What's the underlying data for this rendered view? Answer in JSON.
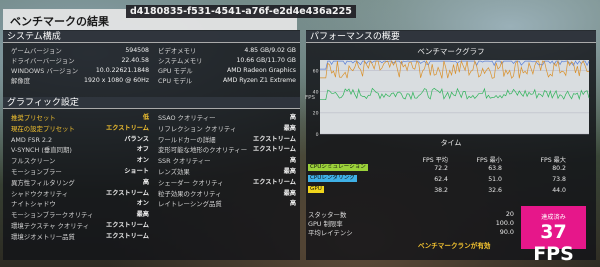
{
  "header": {
    "title": "ベンチマークの結果",
    "id": "d4180835-f531-4541-a76f-e2d4e436a225"
  },
  "system": {
    "title": "システム構成",
    "left": [
      {
        "label": "ゲームバージョン",
        "value": "594508"
      },
      {
        "label": "ドライバーバージョン",
        "value": "22.40.58"
      },
      {
        "label": "WINDOWS バージョン",
        "value": "10.0.22621.1848"
      },
      {
        "label": "解像度",
        "value": "1920 x 1080 @ 60Hz"
      }
    ],
    "right": [
      {
        "label": "ビデオメモリ",
        "value": "4.85 GB/9.02 GB"
      },
      {
        "label": "システムメモリ",
        "value": "10.66 GB/11.70 GB"
      },
      {
        "label": "GPU モデル",
        "value": "AMD Radeon Graphics"
      },
      {
        "label": "CPU モデル",
        "value": "AMD Ryzen Z1 Extreme"
      }
    ]
  },
  "graphics": {
    "title": "グラフィック設定",
    "left": [
      {
        "label": "推奨プリセット",
        "value": "低",
        "hl": true
      },
      {
        "label": "現在の設定プリセット",
        "value": "エクストリーム",
        "hl": true
      },
      {
        "label": "AMD FSR 2.2",
        "value": "バランス"
      },
      {
        "label": "V-SYNCH (垂直同期)",
        "value": "オフ"
      },
      {
        "label": "フルスクリーン",
        "value": "オン"
      },
      {
        "label": "モーションブラー",
        "value": "ショート"
      },
      {
        "label": "異方性フィルタリング",
        "value": "高"
      },
      {
        "label": "シャドウクオリティ",
        "value": "エクストリーム"
      },
      {
        "label": "ナイトシャドウ",
        "value": "オン"
      },
      {
        "label": "モーションブラークオリティ",
        "value": "最高"
      },
      {
        "label": "環境テクスチャ クオリティ",
        "value": "エクストリーム"
      },
      {
        "label": "環境ジオメトリー品質",
        "value": "エクストリーム"
      }
    ],
    "right": [
      {
        "label": "SSAO クオリティー",
        "value": "高"
      },
      {
        "label": "リフレクション クオリティ",
        "value": "最高"
      },
      {
        "label": "ワールドカーの詳細",
        "value": "エクストリーム"
      },
      {
        "label": "変形可能な地形のクオリティー",
        "value": "エクストリーム"
      },
      {
        "label": "SSR クオリティー",
        "value": "高"
      },
      {
        "label": "レンズ効果",
        "value": "最高"
      },
      {
        "label": "シェーダー クオリティ",
        "value": "エクストリーム"
      },
      {
        "label": "粒子効果のクオリティ",
        "value": "最高"
      },
      {
        "label": "レイトレーシング品質",
        "value": "高"
      }
    ]
  },
  "performance": {
    "title": "パフォーマンスの概要",
    "graph_title": "ベンチマークグラフ",
    "x_label": "タイム",
    "y_label": "FPS",
    "y_ticks": [
      "60",
      "40",
      "20",
      "0"
    ],
    "col_headers": [
      "FPS 平均",
      "FPS 最小",
      "FPS 最大"
    ],
    "series": [
      {
        "name": "CPUシミュレーション",
        "color": "#9bd13a",
        "avg": "72.2",
        "min": "63.8",
        "max": "80.2"
      },
      {
        "name": "CPUレンダリング",
        "color": "#3fb0e6",
        "avg": "62.4",
        "min": "51.0",
        "max": "73.8"
      },
      {
        "name": "GPU",
        "color": "#f0d51c",
        "avg": "38.2",
        "min": "32.6",
        "max": "44.0"
      }
    ],
    "extra": [
      {
        "label": "スタッター数",
        "value": "20"
      },
      {
        "label": "GPU 制限率",
        "value": "100.0"
      },
      {
        "label": "平均レイテンシ",
        "value": "90.0"
      }
    ],
    "status": "ベンチマークランが有効",
    "badge_label": "達成済み",
    "badge_value": "37 FPS"
  },
  "chart_data": {
    "type": "line",
    "ylim": [
      0,
      70
    ],
    "y_ticks": [
      0,
      20,
      40,
      60
    ],
    "series": [
      {
        "name": "CPUシミュレーション",
        "color": "#9bd13a",
        "avg": 72.2,
        "min": 63.8,
        "max": 80.2
      },
      {
        "name": "CPUレンダリング",
        "color": "#3fb0e6",
        "avg": 62.4,
        "min": 51.0,
        "max": 73.8
      },
      {
        "name": "GPU",
        "color": "#f0d51c",
        "avg": 38.2,
        "min": 32.6,
        "max": 44.0
      }
    ]
  }
}
